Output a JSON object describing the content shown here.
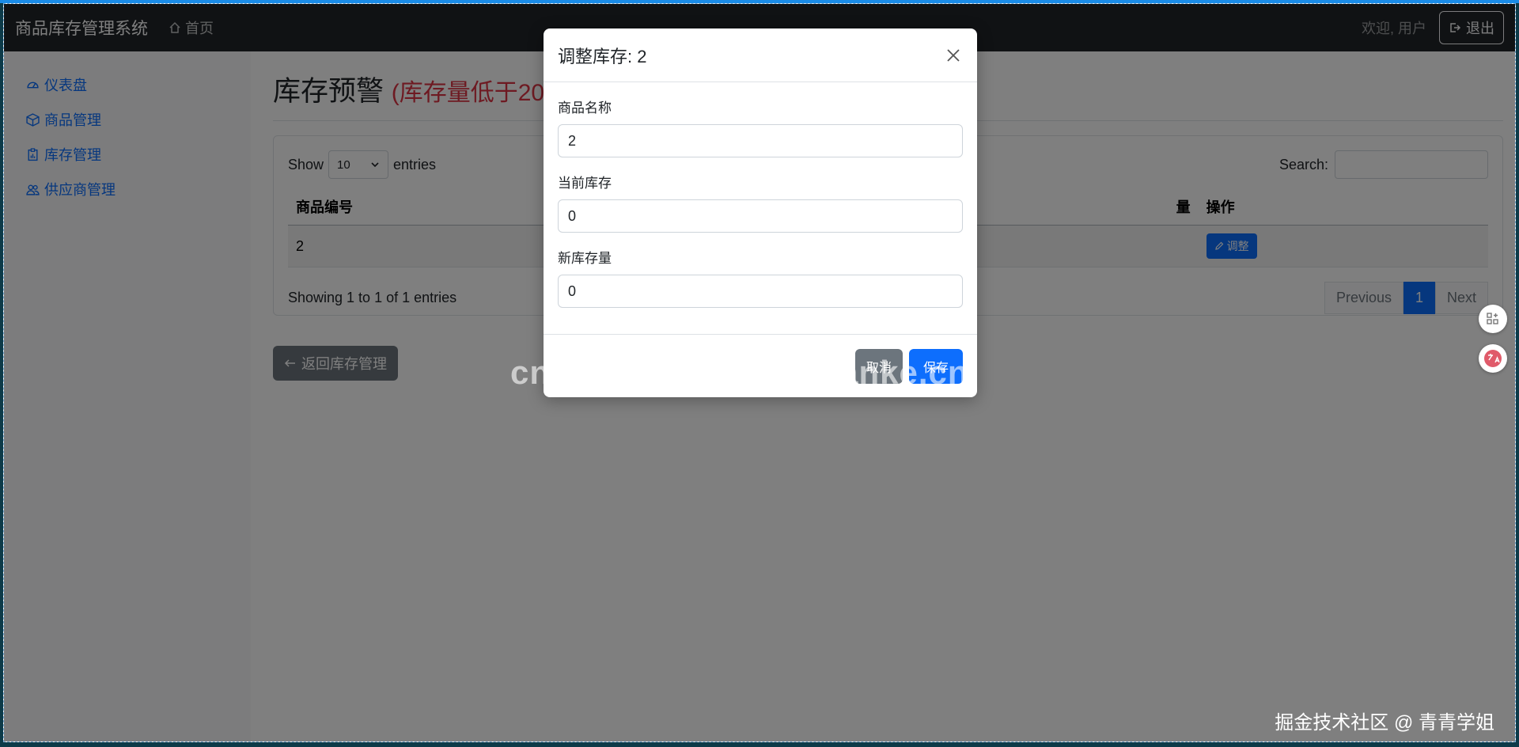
{
  "navbar": {
    "brand": "商品库存管理系统",
    "home": "首页",
    "welcome": "欢迎, 用户",
    "logout": "退出"
  },
  "sidebar": {
    "items": [
      {
        "label": "仪表盘",
        "icon": "speedometer-icon"
      },
      {
        "label": "商品管理",
        "icon": "box-icon"
      },
      {
        "label": "库存管理",
        "icon": "clipboard-icon"
      },
      {
        "label": "供应商管理",
        "icon": "people-icon"
      }
    ]
  },
  "page": {
    "title": "库存预警",
    "subtitle": "(库存量低于20",
    "show_label": "Show",
    "length_value": "10",
    "entries_label": "entries",
    "search_label": "Search:",
    "columns": [
      "商品编号",
      "量",
      "操作"
    ],
    "rows": [
      {
        "id": "2",
        "action": "调整"
      }
    ],
    "info": "Showing 1 to 1 of 1 entries",
    "pager": {
      "prev": "Previous",
      "page": "1",
      "next": "Next"
    },
    "back": "返回库存管理"
  },
  "modal": {
    "title": "调整库存: 2",
    "fields": [
      {
        "label": "商品名称",
        "value": "2"
      },
      {
        "label": "当前库存",
        "value": "0"
      },
      {
        "label": "新库存量",
        "value": "0"
      }
    ],
    "cancel": "取消",
    "save": "保存"
  },
  "watermark": "cn围观客www.weiguanke.cn",
  "credit": "掘金技术社区 @ 青青学姐",
  "colors": {
    "primary": "#0d6efd",
    "danger": "#dc3545",
    "navbar": "#212529",
    "secondary": "#6c757d"
  }
}
